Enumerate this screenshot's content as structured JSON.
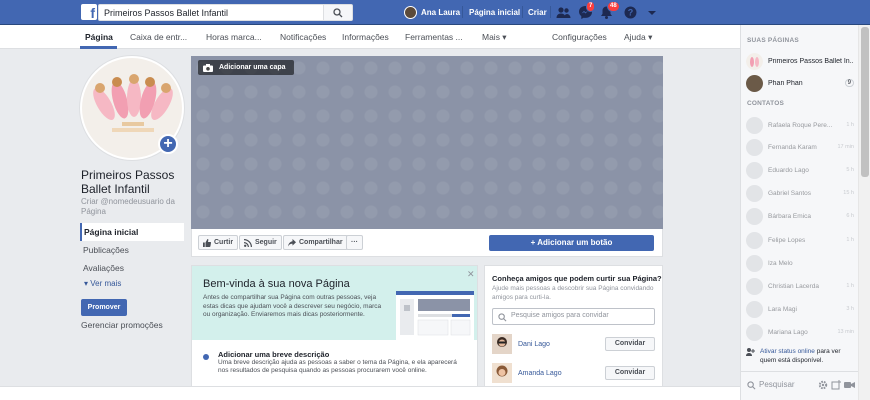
{
  "topbar": {
    "logo": "f",
    "search_value": "Primeiros Passos Ballet Infantil",
    "user_name": "Ana Laura",
    "home_label": "Página inicial",
    "create_label": "Criar",
    "messages_badge": "7",
    "notifications_badge": "48"
  },
  "tabs": [
    {
      "label": "Página"
    },
    {
      "label": "Caixa de entr..."
    },
    {
      "label": "Horas marca..."
    },
    {
      "label": "Notificações"
    },
    {
      "label": "Informações"
    },
    {
      "label": "Ferramentas ..."
    },
    {
      "label": "Mais ▾"
    },
    {
      "label": "Configurações"
    },
    {
      "label": "Ajuda ▾"
    }
  ],
  "page": {
    "name": "Primeiros Passos Ballet Infantil",
    "username_prompt": "Criar @nomedeusuario da Página",
    "nav": [
      "Página inicial",
      "Publicações",
      "Avaliações"
    ],
    "see_more": "Ver mais",
    "promote": "Promover",
    "promotions_manager": "Gerenciar promoções"
  },
  "cover": {
    "add_cover": "Adicionar uma capa"
  },
  "actions": {
    "like": "Curtir",
    "follow": "Seguir",
    "share": "Compartilhar",
    "more": "···",
    "add_button": "+ Adicionar um botão"
  },
  "welcome": {
    "title": "Bem-vinda à sua nova Página",
    "text": "Antes de compartilhar sua Página com outras pessoas, veja estas dicas que ajudam você a descrever seu negócio, marca ou organização. Enviaremos mais dicas posteriormente.",
    "close": "✕",
    "step_title": "Adicionar uma breve descrição",
    "step_text": "Uma breve descrição ajuda as pessoas a saber o tema da Página, e ela aparecerá nos resultados de pesquisa quando as pessoas procurarem você online."
  },
  "invite": {
    "title": "Conheça amigos que podem curtir sua Página?",
    "text": "Ajude mais pessoas a descobrir sua Página convidando amigos para curti-la.",
    "search_placeholder": "Pesquise amigos para convidar",
    "friends": [
      {
        "name": "Dani Lago",
        "button": "Convidar"
      },
      {
        "name": "Amanda Lago",
        "button": "Convidar"
      }
    ]
  },
  "sidebar": {
    "pages_heading": "SUAS PÁGINAS",
    "pages": [
      {
        "name": "Primeiros Passos Ballet In...",
        "count": ""
      },
      {
        "name": "Phan Phan",
        "count": "9"
      }
    ],
    "contacts_heading": "CONTATOS",
    "contacts": [
      {
        "name": "Rafaela Roque Pere...",
        "time": "1 h"
      },
      {
        "name": "Fernanda Karam",
        "time": "17 min"
      },
      {
        "name": "Eduardo Lago",
        "time": "5 h"
      },
      {
        "name": "Gabriel Santos",
        "time": "15 h"
      },
      {
        "name": "Bárbara Emica",
        "time": "6 h"
      },
      {
        "name": "Felipe Lopes",
        "time": "1 h"
      },
      {
        "name": "Iza Melo",
        "time": ""
      },
      {
        "name": "Christian Lacerda",
        "time": "1 h"
      },
      {
        "name": "Lara Magi",
        "time": "3 h"
      },
      {
        "name": "Mariana Lago",
        "time": "13 min"
      }
    ],
    "status_link": "Ativar status online",
    "status_text": " para ver quem está disponível.",
    "search": "Pesquisar"
  },
  "colors": {
    "brand": "#4267b2",
    "cover": "#8b93a7",
    "welcome_bg": "#d3f0ec"
  }
}
